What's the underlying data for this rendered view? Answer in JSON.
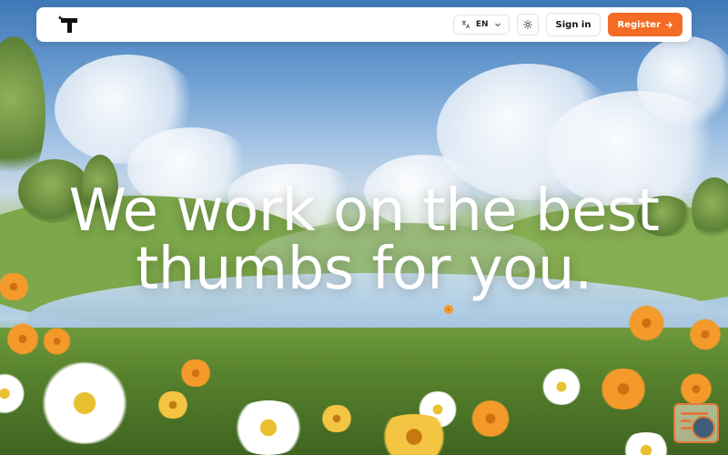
{
  "nav": {
    "logo_alt": "T",
    "language": {
      "label": "EN",
      "icon": "translate-icon"
    },
    "theme_icon": "sun-icon",
    "signin_label": "Sign in",
    "register_label": "Register",
    "register_icon": "arrow-right-icon"
  },
  "hero": {
    "headline_line1": "We work on the best",
    "headline_line2": "thumbs for you.",
    "background": "meadow-lake-flowers-landscape"
  },
  "widget": {
    "icon": "chat-support-icon"
  },
  "colors": {
    "accent": "#f36b24",
    "navbar_bg": "#ffffff",
    "headline": "#ffffff"
  }
}
